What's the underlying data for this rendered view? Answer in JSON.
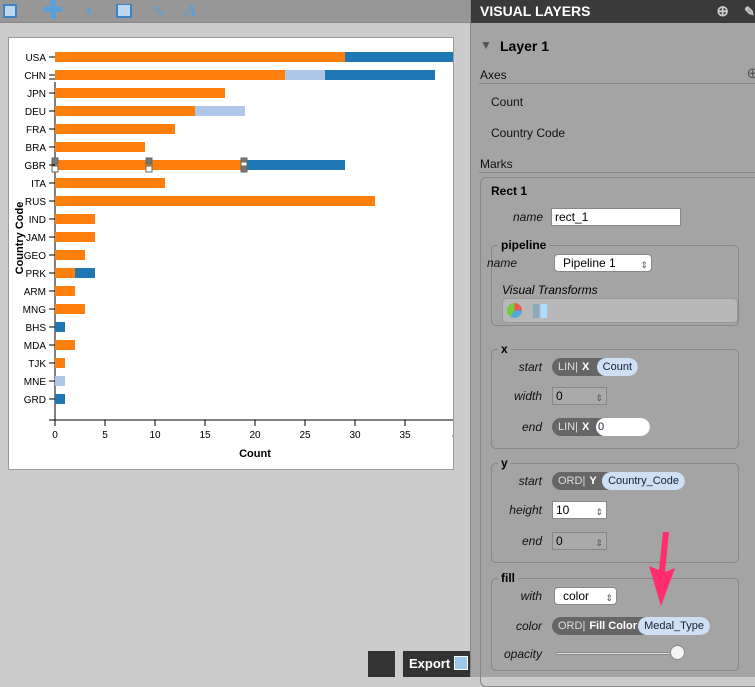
{
  "toolbar": {
    "tools": [
      {
        "icon": "rect-icon"
      },
      {
        "icon": "symbol-plus-icon"
      },
      {
        "icon": "arc-icon"
      },
      {
        "icon": "area-icon"
      },
      {
        "icon": "line-icon"
      },
      {
        "icon": "text-icon",
        "glyph": "A"
      }
    ]
  },
  "chart_data": {
    "type": "bar",
    "orientation": "horizontal",
    "stacked": true,
    "xlabel": "Count",
    "ylabel": "Country Code",
    "xlim": [
      0,
      40
    ],
    "xticks": [
      "0",
      "5",
      "10",
      "15",
      "20",
      "25",
      "30",
      "35",
      "4"
    ],
    "categories": [
      "USA",
      "CHN",
      "JPN",
      "DEU",
      "FRA",
      "BRA",
      "GBR",
      "ITA",
      "RUS",
      "IND",
      "JAM",
      "GEO",
      "PRK",
      "ARM",
      "MNG",
      "BHS",
      "MDA",
      "TJK",
      "MNE",
      "GRD"
    ],
    "series": [
      {
        "color": "#ff7f0e",
        "values": [
          29,
          23,
          17,
          14,
          12,
          9,
          19,
          11,
          32,
          4,
          4,
          3,
          2,
          2,
          3,
          0,
          2,
          1,
          0,
          0
        ]
      },
      {
        "color": "#aec7e8",
        "values": [
          0,
          4,
          0,
          5,
          0,
          0,
          0,
          0,
          0,
          0,
          0,
          0,
          0,
          0,
          0,
          0,
          0,
          0,
          1,
          0
        ]
      },
      {
        "color": "#1f77b4",
        "values": [
          11,
          11,
          0,
          0,
          0,
          0,
          10,
          0,
          0,
          0,
          0,
          0,
          2,
          0,
          0,
          1,
          0,
          0,
          0,
          1
        ]
      }
    ]
  },
  "footer": {
    "export_label": "Export"
  },
  "panel": {
    "title": "VISUAL LAYERS",
    "layer": "Layer 1",
    "axes_label": "Axes",
    "axes": [
      "Count",
      "Country Code"
    ],
    "marks_label": "Marks",
    "mark": {
      "title": "Rect 1",
      "name_label": "name",
      "name_value": "rect_1",
      "pipeline": {
        "legend": "pipeline",
        "name_label": "name",
        "name_value": "Pipeline 1",
        "transforms_label": "Visual Transforms"
      },
      "x": {
        "legend": "x",
        "start_label": "start",
        "start_scale": "LIN",
        "start_axis": "X",
        "start_field": "Count",
        "width_label": "width",
        "width_value": "0",
        "end_label": "end",
        "end_scale": "LIN",
        "end_axis": "X",
        "end_value": "0"
      },
      "y": {
        "legend": "y",
        "start_label": "start",
        "start_scale": "ORD",
        "start_axis": "Y",
        "start_field": "Country_Code",
        "height_label": "height",
        "height_value": "10",
        "end_label": "end",
        "end_value": "0"
      },
      "fill": {
        "legend": "fill",
        "with_label": "with",
        "with_value": "color",
        "color_label": "color",
        "color_scale": "ORD",
        "color_prop": "Fill Color",
        "color_field": "Medal_Type",
        "opacity_label": "opacity",
        "opacity": 1
      }
    }
  },
  "annotation": {
    "arrow_color": "#ff2d6e"
  }
}
